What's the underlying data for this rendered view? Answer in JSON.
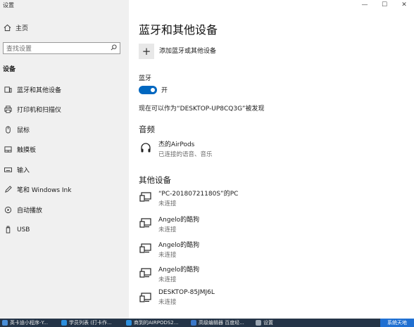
{
  "window": {
    "title": "设置",
    "minimize": "—",
    "maximize": "☐",
    "close": "✕"
  },
  "sidebar": {
    "home": "主页",
    "search_placeholder": "查找设置",
    "section": "设备",
    "items": [
      {
        "label": "蓝牙和其他设备",
        "icon": "bluetooth-icon"
      },
      {
        "label": "打印机和扫描仪",
        "icon": "printer-icon"
      },
      {
        "label": "鼠标",
        "icon": "mouse-icon"
      },
      {
        "label": "触摸板",
        "icon": "touchpad-icon"
      },
      {
        "label": "输入",
        "icon": "keyboard-icon"
      },
      {
        "label": "笔和 Windows Ink",
        "icon": "pen-icon"
      },
      {
        "label": "自动播放",
        "icon": "autoplay-icon"
      },
      {
        "label": "USB",
        "icon": "usb-icon"
      }
    ]
  },
  "main": {
    "title": "蓝牙和其他设备",
    "add_label": "添加蓝牙或其他设备",
    "bluetooth_label": "蓝牙",
    "toggle_state": "开",
    "discover_text": "现在可以作为“DESKTOP-UP8CQ3G”被发现",
    "audio_heading": "音频",
    "audio_devices": [
      {
        "name": "杰的AirPods",
        "status": "已连接的语音、音乐",
        "icon": "headphones-icon"
      }
    ],
    "other_heading": "其他设备",
    "other_devices": [
      {
        "name": "“PC-20180721180S”的PC",
        "status": "未连接"
      },
      {
        "name": "Angelo的酷狗",
        "status": "未连接"
      },
      {
        "name": "Angelo的酷狗",
        "status": "未连接"
      },
      {
        "name": "Angelo的酷狗",
        "status": "未连接"
      },
      {
        "name": "DESKTOP-85JMJ6L",
        "status": "未连接"
      }
    ]
  },
  "taskbar": {
    "items": [
      {
        "label": "英卡迪小程序-Y...",
        "color": "#4a8fd8"
      },
      {
        "label": "学员列表 (打卡作...",
        "color": "#2d8fdd"
      },
      {
        "label": "商到的AIRPODS2...",
        "color": "#2d8fdd"
      },
      {
        "label": "高级编辑器 百度经...",
        "color": "#3a78c9"
      },
      {
        "label": "设置",
        "color": "#9aa5b1"
      }
    ],
    "badge": "系统天地"
  }
}
